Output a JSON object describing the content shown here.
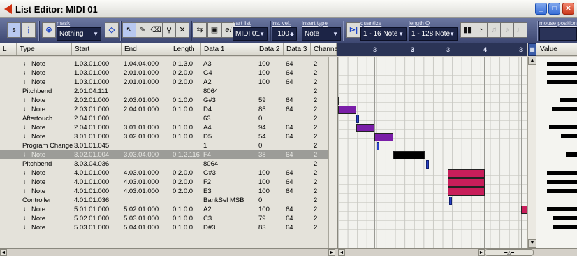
{
  "window": {
    "title": "List Editor: MIDI 01"
  },
  "toolbar": {
    "mask": {
      "label": "mask",
      "value": "Nothing"
    },
    "part_list": {
      "label": "part list",
      "value": "MIDI 01"
    },
    "ins_vel": {
      "label": "ins. vel.",
      "value": "100"
    },
    "insert_type": {
      "label": "insert type",
      "value": "Note"
    },
    "quantize": {
      "label": "quantize",
      "value": "1 - 16 Note"
    },
    "length_q": {
      "label": "length Q",
      "value": "1 - 128 Note"
    },
    "mouse_position": {
      "label": "mouse position"
    }
  },
  "columns": [
    "L",
    "Type",
    "Start",
    "End",
    "Length",
    "Data 1",
    "Data 2",
    "Data 3",
    "Channel"
  ],
  "value_header": "Value",
  "ruler_labels": [
    "3",
    "3",
    "3",
    "4",
    "3"
  ],
  "rows": [
    {
      "type": "Note",
      "is_note": true,
      "start": "1.03.01.000",
      "end": "1.04.04.000",
      "length": "0.1.3.0",
      "d1": "A3",
      "d2": "100",
      "d3": "64",
      "ch": "2"
    },
    {
      "type": "Note",
      "is_note": true,
      "start": "1.03.01.000",
      "end": "2.01.01.000",
      "length": "0.2.0.0",
      "d1": "G4",
      "d2": "100",
      "d3": "64",
      "ch": "2"
    },
    {
      "type": "Note",
      "is_note": true,
      "start": "1.03.01.000",
      "end": "2.01.01.000",
      "length": "0.2.0.0",
      "d1": "A2",
      "d2": "100",
      "d3": "64",
      "ch": "2"
    },
    {
      "type": "Pitchbend",
      "is_note": false,
      "start": "2.01.04.111",
      "end": "",
      "length": "",
      "d1": "8064",
      "d2": "",
      "d3": "",
      "ch": "2"
    },
    {
      "type": "Note",
      "is_note": true,
      "start": "2.02.01.000",
      "end": "2.03.01.000",
      "length": "0.1.0.0",
      "d1": "G#3",
      "d2": "59",
      "d3": "64",
      "ch": "2"
    },
    {
      "type": "Note",
      "is_note": true,
      "start": "2.03.01.000",
      "end": "2.04.01.000",
      "length": "0.1.0.0",
      "d1": "D4",
      "d2": "85",
      "d3": "64",
      "ch": "2"
    },
    {
      "type": "Aftertouch",
      "is_note": false,
      "start": "2.04.01.000",
      "end": "",
      "length": "",
      "d1": "63",
      "d2": "0",
      "d3": "",
      "ch": "2"
    },
    {
      "type": "Note",
      "is_note": true,
      "start": "2.04.01.000",
      "end": "3.01.01.000",
      "length": "0.1.0.0",
      "d1": "A4",
      "d2": "94",
      "d3": "64",
      "ch": "2"
    },
    {
      "type": "Note",
      "is_note": true,
      "start": "3.01.01.000",
      "end": "3.02.01.000",
      "length": "0.1.0.0",
      "d1": "D5",
      "d2": "54",
      "d3": "64",
      "ch": "2"
    },
    {
      "type": "Program Change",
      "is_note": false,
      "start": "3.01.01.045",
      "end": "",
      "length": "",
      "d1": "1",
      "d2": "0",
      "d3": "",
      "ch": "2"
    },
    {
      "type": "Note",
      "is_note": true,
      "selected": true,
      "start": "3.02.01.004",
      "end": "3.03.04.000",
      "length": "0.1.2.116",
      "d1": "F4",
      "d2": "38",
      "d3": "64",
      "ch": "2"
    },
    {
      "type": "Pitchbend",
      "is_note": false,
      "start": "3.03.04.036",
      "end": "",
      "length": "",
      "d1": "8064",
      "d2": "",
      "d3": "",
      "ch": "2"
    },
    {
      "type": "Note",
      "is_note": true,
      "start": "4.01.01.000",
      "end": "4.03.01.000",
      "length": "0.2.0.0",
      "d1": "G#3",
      "d2": "100",
      "d3": "64",
      "ch": "2"
    },
    {
      "type": "Note",
      "is_note": true,
      "start": "4.01.01.000",
      "end": "4.03.01.000",
      "length": "0.2.0.0",
      "d1": "F2",
      "d2": "100",
      "d3": "64",
      "ch": "2"
    },
    {
      "type": "Note",
      "is_note": true,
      "start": "4.01.01.000",
      "end": "4.03.01.000",
      "length": "0.2.0.0",
      "d1": "E3",
      "d2": "100",
      "d3": "64",
      "ch": "2"
    },
    {
      "type": "Controller",
      "is_note": false,
      "start": "4.01.01.036",
      "end": "",
      "length": "",
      "d1": "BankSel MSB",
      "d2": "0",
      "d3": "",
      "ch": "2"
    },
    {
      "type": "Note",
      "is_note": true,
      "start": "5.01.01.000",
      "end": "5.02.01.000",
      "length": "0.1.0.0",
      "d1": "A2",
      "d2": "100",
      "d3": "64",
      "ch": "2"
    },
    {
      "type": "Note",
      "is_note": true,
      "start": "5.02.01.000",
      "end": "5.03.01.000",
      "length": "0.1.0.0",
      "d1": "C3",
      "d2": "79",
      "d3": "64",
      "ch": "2"
    },
    {
      "type": "Note",
      "is_note": true,
      "start": "5.03.01.000",
      "end": "5.04.01.000",
      "length": "0.1.0.0",
      "d1": "D#3",
      "d2": "83",
      "d3": "64",
      "ch": "2"
    }
  ],
  "colors": {
    "note": "#c81e5a",
    "note_alt": "#7a1ea8",
    "tick": "#2840c8",
    "selected_event": "#000000"
  },
  "icons": [
    "snap-icon",
    "solo-icon",
    "mask-icon",
    "arrow-tool-icon",
    "pencil-tool-icon",
    "eraser-tool-icon",
    "zoom-tool-icon",
    "mute-tool-icon",
    "quantize-icon",
    "edit-icon",
    "snap-magnet-icon",
    "step-record-icon",
    "metronome-icon",
    "keyboard-icon",
    "note-icon"
  ]
}
